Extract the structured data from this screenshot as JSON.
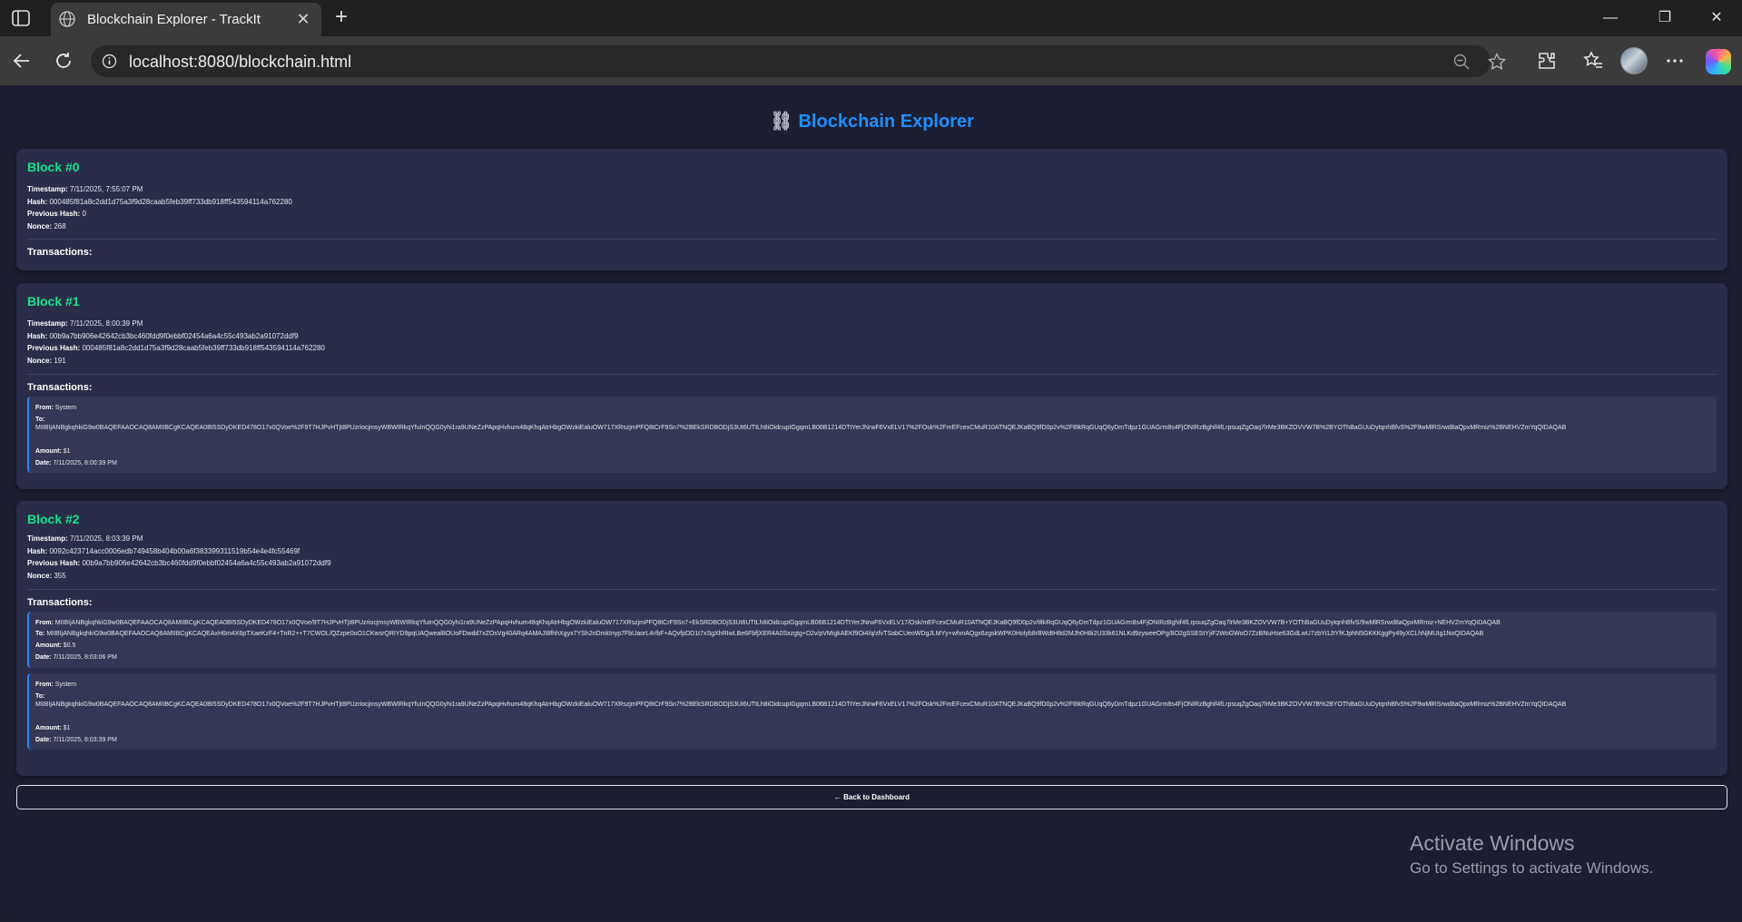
{
  "browser": {
    "tab_title": "Blockchain Explorer - TrackIt",
    "url": "localhost:8080/blockchain.html",
    "tab_close_glyph": "✕",
    "new_tab_glyph": "+",
    "minimize_glyph": "—",
    "restore_glyph": "❐",
    "close_glyph": "✕"
  },
  "page": {
    "title_icon": "⛓",
    "title": "Blockchain Explorer",
    "transactions_label": "Transactions:",
    "back_button": "← Back to Dashboard"
  },
  "labels": {
    "timestamp": "Timestamp:",
    "hash": "Hash:",
    "previous_hash": "Previous Hash:",
    "nonce": "Nonce:",
    "from": "From:",
    "to": "To:",
    "amount": "Amount:",
    "date": "Date:"
  },
  "blocks": [
    {
      "title": "Block #0",
      "timestamp": "7/11/2025, 7:55:07 PM",
      "hash": "000485f81a8c2dd1d75a3f9d28caab5feb39ff733db918ff543594114a762280",
      "previous_hash": "0",
      "nonce": "268",
      "transactions": []
    },
    {
      "title": "Block #1",
      "timestamp": "7/11/2025, 8:00:39 PM",
      "hash": "00b9a7bb906e42642cb3bc460fdd9f0ebbf02454a6a4c55c493ab2a91072ddf9",
      "previous_hash": "000485f81a8c2dd1d75a3f9d28caab5feb39ff733db918ff543594114a762280",
      "nonce": "191",
      "transactions": [
        {
          "from": "System",
          "to": "MIIBIjANBgkqhkiG9w0BAQEFAAOCAQ8AMIIBCgKCAQEA0BI5SDyDKED478O17x0QVoe%2F9T7HJPvHTjt8PUzriocjmsyWBWIRkqYfuInQQG0yhi1ra9UNeZzPApqHvhum48qKhqAtrHbgOWzkiEaluOW717XRszjmPFQ8tCrF9Sn7%2BEkSRDBODjS3Ut6UTtLh8iOidcupIGgqmLB06B1214DTtYerJNrwF6VxELV17%2FOsk%2FmEFcexCMuR10ATNQEJKaBQ9fD0p2v%2FtltkRqGUqQ6yDmTdpz1GUAGrm8s4FjONIRzBghif4fLrpsuqZgOaq7lrMe3BKZOVVW7B%2BYOThBaGUuDytqnhBfvS%2F9wMlRSrwd8aQpxMRmiz%2BNEHVZmYqQIDAQAB",
          "amount": "$1",
          "date": "7/11/2025, 8:00:39 PM"
        }
      ]
    },
    {
      "title": "Block #2",
      "timestamp": "7/11/2025, 8:03:39 PM",
      "hash": "0092c423714acc0006edb749458b404b00a6f383399311519b54e4e4fc55469f",
      "previous_hash": "00b9a7bb906e42642cb3bc460fdd9f0ebbf02454a6a4c55c493ab2a91072ddf9",
      "nonce": "355",
      "transactions": [
        {
          "from": "MIIBIjANBgkqhkiG9w0BAQEFAAOCAQ8AMIIBCgKCAQEA0BI5SDyDKED478O17x0QVoe/9T7HJPvHTjt8PUzriocjmsyWBWIRkqYfuInQQG0yhi1ra9UNeZzPApqHvhum48qKhqAtrHbgOWzkiEaluOW717XRszjmPFQ8tCrF9Sn7+EkSRDBODjS3Ut6UTtLh8iOidcupIGgqmLB06B1214DTtYerJNrwF6VxELV17/Osk/mEFcexCMuR10ATNQEJKaBQ9fD0p2v/tltkRqGUqQ6yDmTdpz1GUAGrm8s4FjONIRzBghif4fLrpsuqZgOaq7lrMe3BKZOVVW7B+YOThBaGUuDytqnhBfvS/9wMlRSrwd8aQpxMRmiz+NEHVZmYqQIDAQAB",
          "to": "MIIBIjANBgkqhkiG9w0BAQEFAAOCAQ8AMIIBCgKCAQEAxH6m4X6pTXaeKzF4+TnR2++T7CWOL/QZzpe0oO1CKwsrQRIYD9pqUAQweal8OUoFDwdd7xZOsVg40ARq4AMAJI8fhhXgyx7YSh2nDmkInyp7FbUaorL4r/bF+AQvfpDD1t7xSgXhRIwLBe6FbfjXER4A0Sxzgtg+D2v/pVMigkAEKf9Oi4/q/zfvTSabCUeoWDgJLMYy+wfxnAQgx6zgskWPK0Holyb8rBWdtH8d2MJh0H8i2U33k61NLKd9zyweeOPg/8O2gSSEStYjiF2WoGWoO7ZzBNuHse63GdLwU7zbYi1JtYfKJphN5GKKKggPy49yXCLhNjMUIg1NoQIDAQAB",
          "amount": "$0.5",
          "date": "7/11/2025, 8:03:06 PM"
        },
        {
          "from": "System",
          "to": "MIIBIjANBgkqhkiG9w0BAQEFAAOCAQ8AMIIBCgKCAQEA0BI5SDyDKED478O17x0QVoe%2F9T7HJPvHTjt8PUzriocjmsyWBWIRkqYfuInQQG0yhi1ra9UNeZzPApqHvhum48qKhqAtrHbgOWzkiEaluOW717XRszjmPFQ8tCrF9Sn7%2BEkSRDBODjS3Ut6UTtLh8iOidcupIGgqmLB06B1214DTtYerJNrwF6VxELV17%2FOsk%2FmEFcexCMuR10ATNQEJKaBQ9fD0p2v%2FtltkRqGUqQ6yDmTdpz1GUAGrm8s4FjONIRzBghif4fLrpsuqZgOaq7lrMe3BKZOVVW7B%2BYOThBaGUuDytqnhBfvS%2F9wMlRSrwd8aQpxMRmiz%2BNEHVZmYqQIDAQAB",
          "amount": "$1",
          "date": "7/11/2025, 8:03:39 PM"
        }
      ]
    }
  ],
  "watermark": {
    "line1": "Activate Windows",
    "line2": "Go to Settings to activate Windows."
  }
}
